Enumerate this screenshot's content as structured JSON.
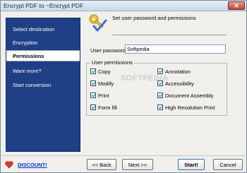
{
  "window": {
    "title": "Encrypt PDF to ~Encrypt PDF",
    "close_label": "✕"
  },
  "sidebar": {
    "items": [
      {
        "label": "Select destination",
        "active": false
      },
      {
        "label": "Encryption",
        "active": false
      },
      {
        "label": "Permissions",
        "active": true
      },
      {
        "label": "Want more?",
        "active": false
      },
      {
        "label": "Start conversion",
        "active": false
      }
    ]
  },
  "header": {
    "title": "Set user password and permissions",
    "icon": "key-check-icon"
  },
  "password": {
    "label": "User password:",
    "value": "Softpedia"
  },
  "permissions": {
    "legend": "User permissions",
    "left": [
      {
        "label": "Copy",
        "checked": true
      },
      {
        "label": "Modify",
        "checked": true
      },
      {
        "label": "Print",
        "checked": true
      },
      {
        "label": "Form fill",
        "checked": true
      }
    ],
    "right": [
      {
        "label": "Annotation",
        "checked": true
      },
      {
        "label": "Accessibility",
        "checked": true
      },
      {
        "label": "Document Assembly",
        "checked": true
      },
      {
        "label": "High Resolution Print",
        "checked": true
      }
    ]
  },
  "watermark": "SOFTPEDIA",
  "footer": {
    "discount": "DISCOUNT!",
    "back": "<< Back",
    "next": "Next >>",
    "start": "Start!",
    "cancel": "Cancel",
    "heart_icon": "heart-icon"
  },
  "colors": {
    "sidebar_bg": "#1f3f86",
    "link": "#0033cc"
  }
}
